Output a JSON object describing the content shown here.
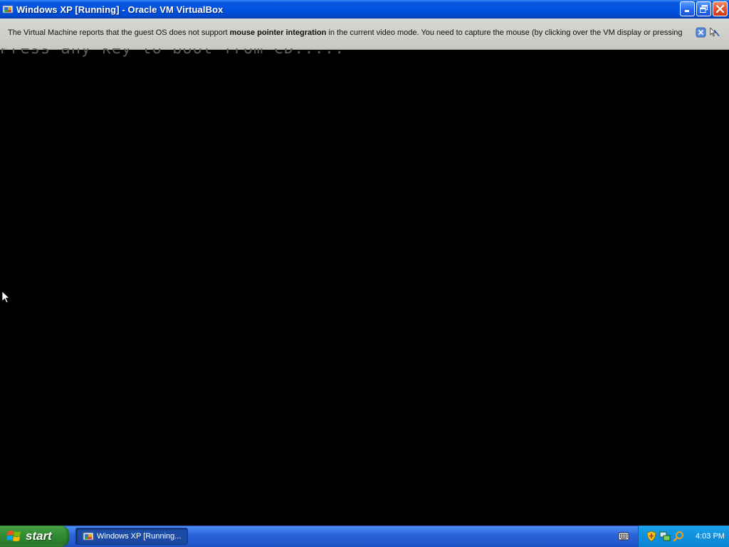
{
  "window": {
    "title": "Windows XP [Running] - Oracle VM VirtualBox",
    "app_icon": "virtualbox-icon",
    "buttons": {
      "minimize": "minimize-icon",
      "restore": "restore-icon",
      "close": "close-icon"
    }
  },
  "notification": {
    "text_before": "The Virtual Machine reports that the guest OS does not support ",
    "text_bold": "mouse pointer integration",
    "text_after": " in the current video mode. You need to capture the mouse (by clicking over the VM display or pressing",
    "icons": [
      "close-message-icon",
      "mouse-integration-icon"
    ]
  },
  "vm": {
    "boot_message": "Press any key to boot from CD....."
  },
  "taskbar": {
    "start_label": "start",
    "task_label": "Windows XP [Running...",
    "clock": "4:03 PM",
    "tray_icons": [
      "security-shield-icon",
      "network-icon",
      "search-icon"
    ]
  },
  "colors": {
    "titlebar_blue": "#0052e0",
    "notify_bg": "#d0d0cb",
    "start_green": "#318a31",
    "tray_blue": "#0f8fdd",
    "boot_text_gray": "#5c5c5c"
  }
}
